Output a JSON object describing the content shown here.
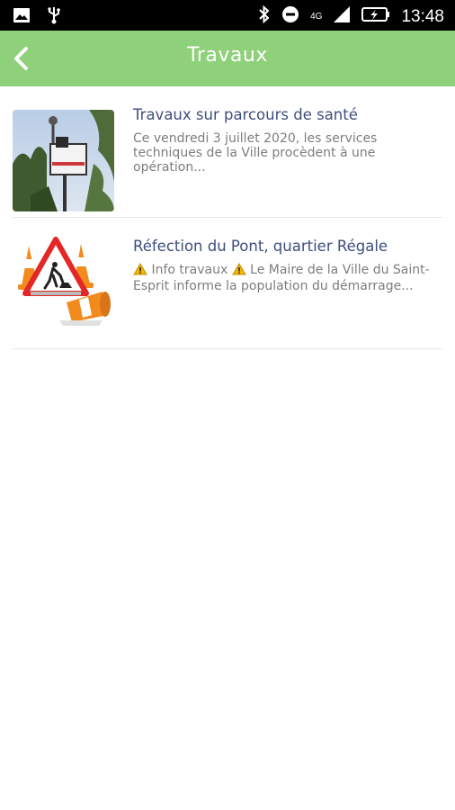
{
  "status_bar": {
    "time": "13:48",
    "network": "4G",
    "icons": [
      "image-icon",
      "usb-icon",
      "bluetooth-icon",
      "do-not-disturb-icon",
      "signal-icon",
      "battery-charging-icon"
    ]
  },
  "header": {
    "title": "Travaux",
    "back_icon": "chevron-left-icon",
    "color": "#8fd07a"
  },
  "articles": [
    {
      "title": "Travaux sur parcours de santé",
      "description": "Ce vendredi 3 juillet 2020, les services techniques de la Ville procèdent à une opération...",
      "thumbnail": "bucket-truck-photo"
    },
    {
      "title": "Réfection du Pont, quartier Régale",
      "description_parts": [
        "Info travaux",
        "Le Maire de la Ville du Saint-Esprit informe la population du démarrage..."
      ],
      "thumbnail": "roadwork-cones-sign"
    }
  ]
}
